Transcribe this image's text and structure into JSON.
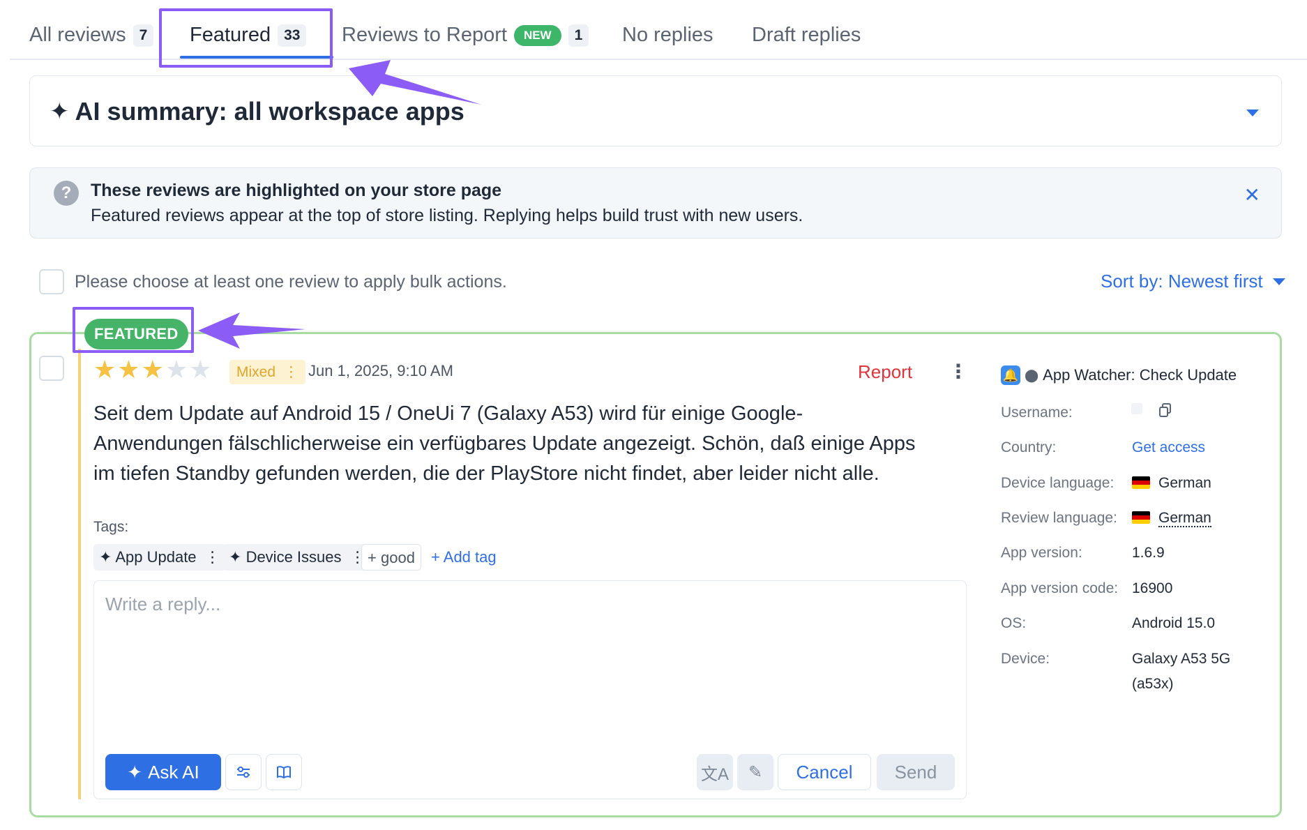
{
  "tabs": [
    {
      "label": "All reviews",
      "count": "7"
    },
    {
      "label": "Featured",
      "count": "33"
    },
    {
      "label": "Reviews to Report",
      "badge": "NEW",
      "count": "1"
    },
    {
      "label": "No replies"
    },
    {
      "label": "Draft replies"
    }
  ],
  "summary": {
    "title": "AI summary: all workspace apps"
  },
  "banner": {
    "title": "These reviews are highlighted on your store page",
    "text": "Featured reviews appear at the top of store listing. Replying helps build trust with new users."
  },
  "bulk": {
    "text": "Please choose at least one review to apply bulk actions."
  },
  "sort": {
    "label": "Sort by: Newest first"
  },
  "review": {
    "badge": "FEATURED",
    "rating": 3,
    "rating_max": 5,
    "sentiment": "Mixed",
    "date": "Jun 1, 2025, 9:10 AM",
    "report_label": "Report",
    "text": "Seit dem Update auf Android 15 / OneUi 7 (Galaxy A53) wird für einige Google-Anwendungen fälschlicherweise ein verfügbares Update angezeigt. Schön, daß einige Apps im tiefen Standby gefunden werden, die der PlayStore nicht findet, aber leider nicht alle.",
    "tags_label": "Tags:",
    "tags": [
      "App Update",
      "Device Issues"
    ],
    "suggested_tag": "good",
    "add_tag_label": "Add tag",
    "reply_placeholder": "Write a reply...",
    "ask_ai_label": "Ask AI",
    "cancel_label": "Cancel",
    "send_label": "Send"
  },
  "meta": {
    "app_name": "App Watcher: Check Update",
    "username_label": "Username:",
    "country_label": "Country:",
    "country_value": "Get access",
    "device_language_label": "Device language:",
    "device_language_value": "German",
    "review_language_label": "Review language:",
    "review_language_value": "German",
    "app_version_label": "App version:",
    "app_version_value": "1.6.9",
    "app_version_code_label": "App version code:",
    "app_version_code_value": "16900",
    "os_label": "OS:",
    "os_value": "Android 15.0",
    "device_label": "Device:",
    "device_value_line1": "Galaxy A53 5G",
    "device_value_line2": "(a53x)"
  },
  "colors": {
    "accent": "#2f6fe4",
    "annotation": "#8b5cf6",
    "featured_green": "#45b469",
    "card_border": "#a8dca2",
    "report_red": "#e0343c",
    "star": "#f5c243"
  }
}
